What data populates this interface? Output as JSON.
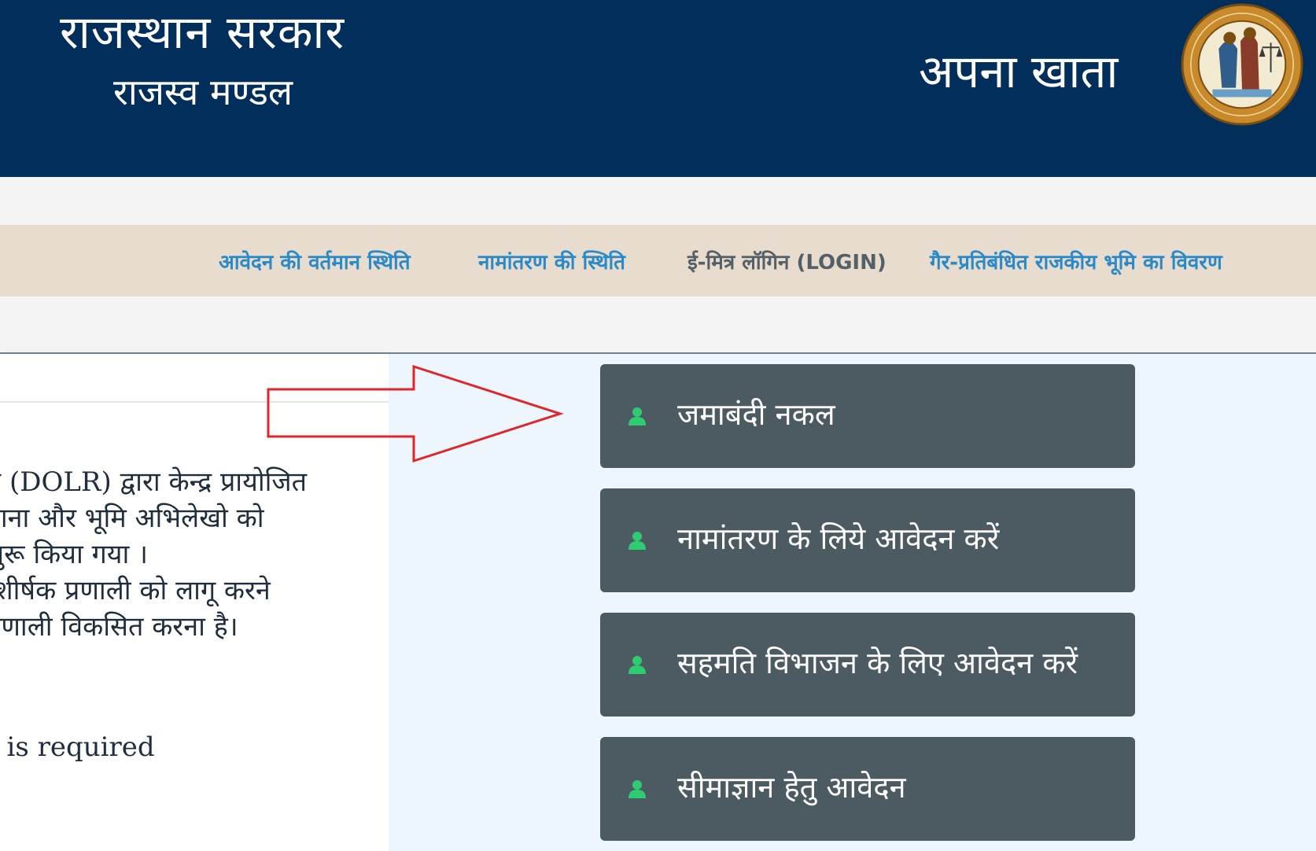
{
  "header": {
    "gov_title": "राजस्थान सरकार",
    "dept_title": "राजस्व मण्डल",
    "portal_title": "अपना खाता",
    "emblem_icon": "emblem-seal-icon"
  },
  "nav": {
    "items": [
      {
        "label": "आवेदन की वर्तमान स्थिति"
      },
      {
        "label": "नामांतरण की स्थिति"
      },
      {
        "label": "ई-मित्र लॉगिन (LOGIN)"
      },
      {
        "label": "गैर-प्रतिबंधित राजकीय भूमि का विवरण"
      }
    ]
  },
  "intro": {
    "lines": [
      "ग (DOLR) द्वारा केन्द्र प्रायोजित",
      "नाना और भूमि अभिलेखो को",
      "शुरू किया गया ।",
      "-शीर्षक प्रणाली को लागू करने",
      "प्रणाली विकसित करना है।"
    ],
    "required_text": "t is required"
  },
  "services": [
    {
      "label": "जमाबंदी नकल",
      "icon": "user-icon"
    },
    {
      "label": "नामांतरण के लिये आवेदन करें",
      "icon": "user-icon"
    },
    {
      "label": "सहमति विभाजन के लिए आवेदन करें",
      "icon": "user-icon"
    },
    {
      "label": "सीमाज्ञान हेतु आवेदन",
      "icon": "user-icon"
    }
  ],
  "colors": {
    "header_bg": "#012e5a",
    "nav_bg": "#e8dccf",
    "nav_link": "#2a8ac8",
    "button_bg": "#4c5a62",
    "icon_green": "#2ecc71",
    "annotation_arrow": "#e0262b"
  }
}
